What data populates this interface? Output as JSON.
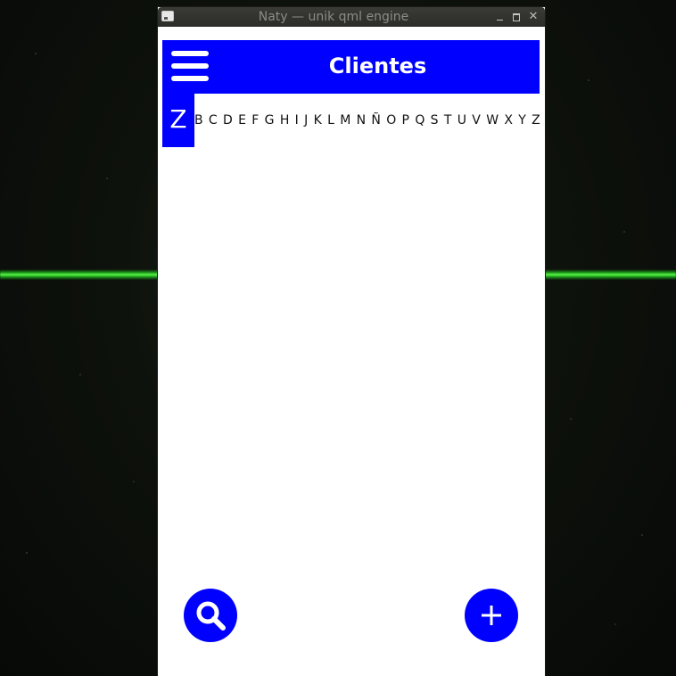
{
  "window": {
    "title": "Naty — unik qml engine"
  },
  "header": {
    "title": "Clientes"
  },
  "alphabet": {
    "selected": "Z",
    "letters": [
      "B",
      "C",
      "D",
      "E",
      "F",
      "G",
      "H",
      "I",
      "J",
      "K",
      "L",
      "M",
      "N",
      "Ñ",
      "O",
      "P",
      "Q",
      "S",
      "T",
      "U",
      "V",
      "W",
      "X",
      "Y",
      "Z"
    ]
  },
  "icons": {
    "menu": "hamburger-menu-icon",
    "search": "search-icon",
    "add": "plus-icon"
  },
  "colors": {
    "accent": "#0000ff",
    "laser": "#33ff33"
  }
}
